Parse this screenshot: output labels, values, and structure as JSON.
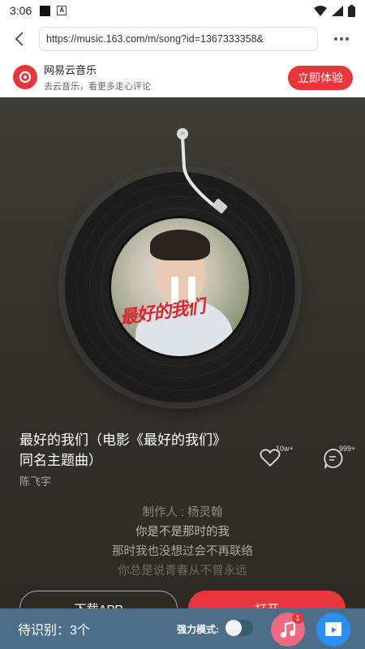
{
  "status_bar": {
    "time": "3:06",
    "a_icon_label": "A"
  },
  "browser": {
    "url": "https://music.163.com/m/song?id=1367333358&"
  },
  "banner": {
    "app_name": "网易云音乐",
    "subtitle": "去云音乐，看更多走心评论",
    "try_label": "立即体验",
    "brand_color": "#e8363d"
  },
  "cover": {
    "art_text": "最好的我们"
  },
  "song": {
    "title": "最好的我们（电影《最好的我们》同名主题曲）",
    "artist": "陈飞宇",
    "likes": "10w+",
    "comments": "999+"
  },
  "lyrics": [
    "制作人 : 杨灵翰",
    "你是不是那时的我",
    "那时我也没想过会不再联络",
    "你总是说青春从不曾永远"
  ],
  "actions": {
    "download_label": "下载APP",
    "open_label": "打开"
  },
  "bottom_bar": {
    "pending_label": "待识别：3个",
    "strong_mode_label": "强力模式:",
    "strong_mode_on": false,
    "music_badge": "1"
  }
}
